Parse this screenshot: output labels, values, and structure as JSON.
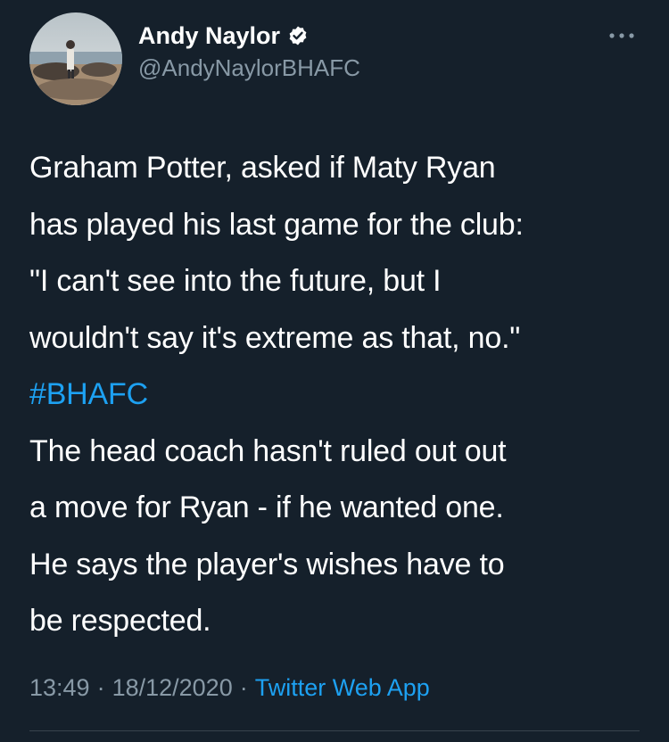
{
  "author": {
    "display_name": "Andy Naylor",
    "handle": "@AndyNaylorBHAFC",
    "verified": true,
    "avatar_icon": "beach-photo-avatar"
  },
  "more_icon": "more-horizontal-icon",
  "tweet": {
    "lines": [
      "Graham Potter, asked if Maty Ryan",
      "has played his last game for the club:",
      "\"I can't see into the future, but I",
      "wouldn't say it's extreme as that, no.\"",
      "#BHAFC",
      "The head coach hasn't ruled out out",
      "a move for Ryan - if he wanted one.",
      "He says the player's wishes have to",
      "be respected."
    ]
  },
  "meta": {
    "time": "13:49",
    "date": "18/12/2020",
    "separator": "·",
    "source": "Twitter Web App"
  },
  "colors": {
    "background": "#15202b",
    "text": "#ffffff",
    "secondary": "#8899a6",
    "accent": "#1da1f2",
    "divider": "#38444d"
  }
}
